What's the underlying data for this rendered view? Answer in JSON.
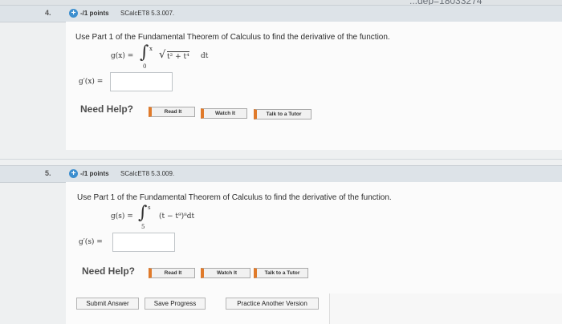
{
  "url_fragment": "...dep=18033274",
  "questions": [
    {
      "number": "4.",
      "points": "-/1 points",
      "code": "SCalcET8 5.3.007.",
      "prompt": "Use Part 1 of the Fundamental Theorem of Calculus to find the derivative of the function.",
      "formula": {
        "lhs": "g(x) =",
        "upper": "x",
        "lower": "0",
        "integrand": "t² + t⁴",
        "dt": "dt"
      },
      "derivative_label": "g′(x) =",
      "answer_value": ""
    },
    {
      "number": "5.",
      "points": "-/1 points",
      "code": "SCalcET8 5.3.009.",
      "prompt": "Use Part 1 of the Fundamental Theorem of Calculus to find the derivative of the function.",
      "formula": {
        "lhs": "g(s) =",
        "upper": "s",
        "lower": "5",
        "integrand": "(t − t⁹)⁸dt"
      },
      "derivative_label": "g′(s) =",
      "answer_value": ""
    }
  ],
  "help": {
    "need_help": "Need Help?",
    "read_it": "Read It",
    "watch_it": "Watch It",
    "talk_to_tutor": "Talk to a Tutor"
  },
  "actions": {
    "submit_answer": "Submit Answer",
    "save_progress": "Save Progress",
    "practice_another": "Practice Another Version"
  },
  "colors": {
    "accent_icon": "#3d8fcf",
    "help_button_stripe": "#e07a2a",
    "header_band": "#dde3e8"
  }
}
